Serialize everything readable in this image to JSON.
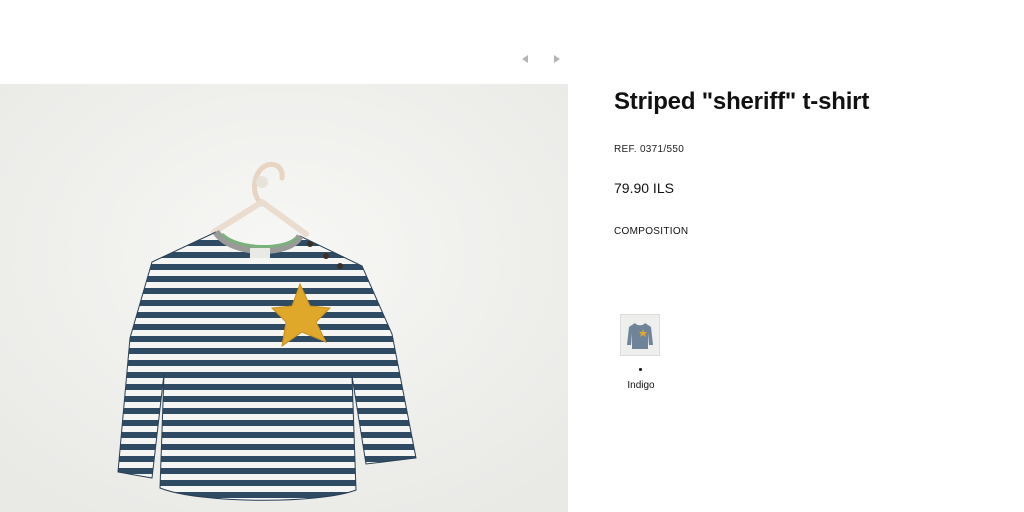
{
  "product": {
    "title": "Striped \"sheriff\" t-shirt",
    "reference": "REF. 0371/550",
    "price": "79.90 ILS",
    "composition_label": "COMPOSITION"
  },
  "colours": [
    {
      "name": "Indigo",
      "selected": true
    }
  ],
  "colors": {
    "stripe_navy": "#2f4a63",
    "stripe_white": "#f5f5f3",
    "star_yellow": "#e0a82a",
    "background": "#f3f3f1",
    "arrow_gray": "#b5b5b5"
  },
  "icons": {
    "prev": "caret-left-icon",
    "next": "caret-right-icon"
  }
}
